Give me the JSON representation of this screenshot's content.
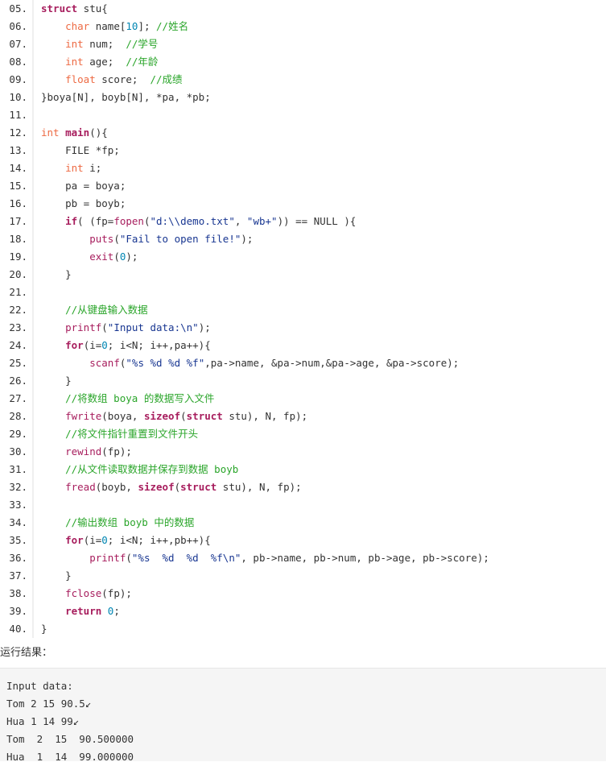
{
  "code_lines": [
    {
      "num": "05.",
      "text": "struct stu{"
    },
    {
      "num": "06.",
      "text": "    char name[10]; //姓名"
    },
    {
      "num": "07.",
      "text": "    int num;  //学号"
    },
    {
      "num": "08.",
      "text": "    int age;  //年龄"
    },
    {
      "num": "09.",
      "text": "    float score;  //成绩"
    },
    {
      "num": "10.",
      "text": "}boya[N], boyb[N], *pa, *pb;"
    },
    {
      "num": "11.",
      "text": ""
    },
    {
      "num": "12.",
      "text": "int main(){"
    },
    {
      "num": "13.",
      "text": "    FILE *fp;"
    },
    {
      "num": "14.",
      "text": "    int i;"
    },
    {
      "num": "15.",
      "text": "    pa = boya;"
    },
    {
      "num": "16.",
      "text": "    pb = boyb;"
    },
    {
      "num": "17.",
      "text": "    if( (fp=fopen(\"d:\\\\demo.txt\", \"wb+\")) == NULL ){"
    },
    {
      "num": "18.",
      "text": "        puts(\"Fail to open file!\");"
    },
    {
      "num": "19.",
      "text": "        exit(0);"
    },
    {
      "num": "20.",
      "text": "    }"
    },
    {
      "num": "21.",
      "text": ""
    },
    {
      "num": "22.",
      "text": "    //从键盘输入数据"
    },
    {
      "num": "23.",
      "text": "    printf(\"Input data:\\n\");"
    },
    {
      "num": "24.",
      "text": "    for(i=0; i<N; i++,pa++){"
    },
    {
      "num": "25.",
      "text": "        scanf(\"%s %d %d %f\",pa->name, &pa->num,&pa->age, &pa->score);"
    },
    {
      "num": "26.",
      "text": "    }"
    },
    {
      "num": "27.",
      "text": "    //将数组 boya 的数据写入文件"
    },
    {
      "num": "28.",
      "text": "    fwrite(boya, sizeof(struct stu), N, fp);"
    },
    {
      "num": "29.",
      "text": "    //将文件指针重置到文件开头"
    },
    {
      "num": "30.",
      "text": "    rewind(fp);"
    },
    {
      "num": "31.",
      "text": "    //从文件读取数据并保存到数据 boyb"
    },
    {
      "num": "32.",
      "text": "    fread(boyb, sizeof(struct stu), N, fp);"
    },
    {
      "num": "33.",
      "text": ""
    },
    {
      "num": "34.",
      "text": "    //输出数组 boyb 中的数据"
    },
    {
      "num": "35.",
      "text": "    for(i=0; i<N; i++,pb++){"
    },
    {
      "num": "36.",
      "text": "        printf(\"%s  %d  %d  %f\\n\", pb->name, pb->num, pb->age, pb->score);"
    },
    {
      "num": "37.",
      "text": "    }"
    },
    {
      "num": "38.",
      "text": "    fclose(fp);"
    },
    {
      "num": "39.",
      "text": "    return 0;"
    },
    {
      "num": "40.",
      "text": "}"
    }
  ],
  "result_label": "运行结果：",
  "output_lines": [
    "Input data:",
    "Tom 2 15 90.5↙",
    "Hua 1 14 99↙",
    "Tom  2  15  90.500000",
    "Hua  1  14  99.000000"
  ],
  "colors": {
    "keyword": "#a71d5d",
    "type": "#ed6a43",
    "comment": "#2aa52a",
    "string": "#183691",
    "number": "#0086b3"
  }
}
